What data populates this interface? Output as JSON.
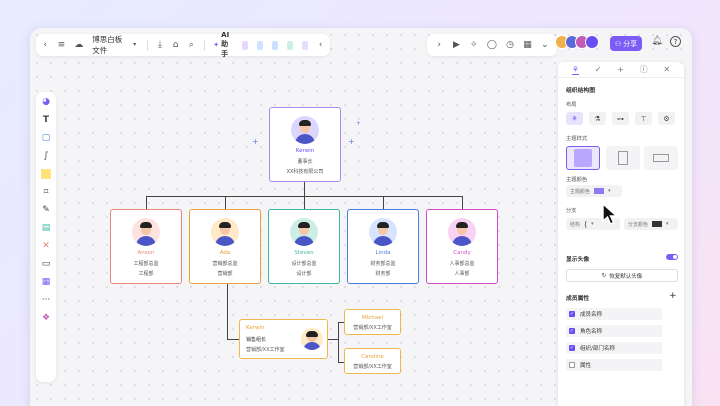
{
  "toolbar": {
    "doc_title": "博思白板文件",
    "ai_label": "AI助手",
    "share_label": "分享"
  },
  "org_root": {
    "name": "Kerwin",
    "title": "董事长",
    "company": "XX科技有限公司"
  },
  "org_level1": [
    {
      "name": "Anson",
      "title": "工程部总监",
      "dept": "工程部",
      "color": "#e8867a",
      "bg": "#fde3e0"
    },
    {
      "name": "Ada",
      "title": "营销部总监",
      "dept": "营销部",
      "color": "#e6a13a",
      "bg": "#ffe9c7"
    },
    {
      "name": "Steven",
      "title": "设计部总监",
      "dept": "设计部",
      "color": "#3fb6a0",
      "bg": "#cdeee6"
    },
    {
      "name": "Linda",
      "title": "财务部总监",
      "dept": "财务部",
      "color": "#4a7fe0",
      "bg": "#d7e4ff"
    },
    {
      "name": "Candy",
      "title": "人事部总监",
      "dept": "人事部",
      "color": "#d34cc7",
      "bg": "#f9d2f3"
    }
  ],
  "org_sub": {
    "name": "Kerwin",
    "title": "销售组长",
    "dept": "营销部/XX工作室"
  },
  "org_sub2": [
    {
      "name": "Michael",
      "dept": "营销部/XX工作室"
    },
    {
      "name": "Caroline",
      "dept": "营销部/XX工作室"
    }
  ],
  "panel": {
    "section_title": "组织结构图",
    "layout_label": "布局",
    "theme_style_label": "主题样式",
    "theme_color_label": "主题颜色",
    "theme_color_select": "主题颜色",
    "branch_label": "分支",
    "structure_select": "结构",
    "branch_color_select": "分支颜色",
    "show_avatar_label": "显示头像",
    "restore_avatar_label": "恢复默认头像",
    "member_props_label": "成员属性",
    "props": [
      {
        "label": "成员名称",
        "checked": true
      },
      {
        "label": "角色名称",
        "checked": true
      },
      {
        "label": "组织/部门名称",
        "checked": true
      },
      {
        "label": "属性",
        "checked": false
      }
    ]
  },
  "colors": {
    "accent": "#7b5cf5",
    "root_border": "#a98bf0",
    "sub_border": "#f0b84a"
  }
}
